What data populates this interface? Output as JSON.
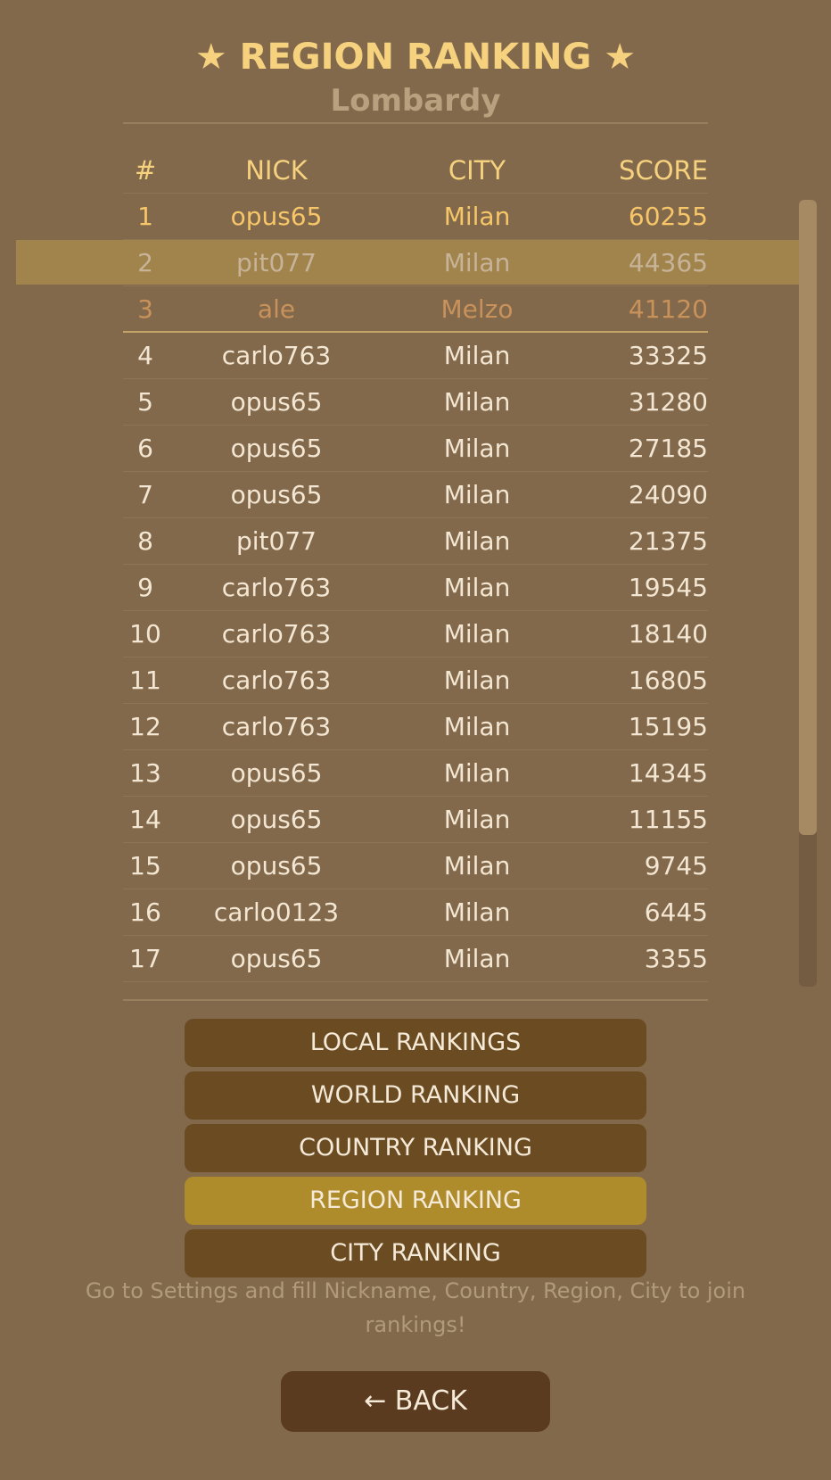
{
  "header": {
    "title": "★ REGION RANKING ★",
    "subtitle": "Lombardy"
  },
  "table": {
    "columns": [
      "#",
      "NICK",
      "CITY",
      "SCORE"
    ],
    "rows": [
      {
        "rank": "1",
        "nick": "opus65",
        "city": "Milan",
        "score": "60255"
      },
      {
        "rank": "2",
        "nick": "pit077",
        "city": "Milan",
        "score": "44365"
      },
      {
        "rank": "3",
        "nick": "ale",
        "city": "Melzo",
        "score": "41120"
      },
      {
        "rank": "4",
        "nick": "carlo763",
        "city": "Milan",
        "score": "33325"
      },
      {
        "rank": "5",
        "nick": "opus65",
        "city": "Milan",
        "score": "31280"
      },
      {
        "rank": "6",
        "nick": "opus65",
        "city": "Milan",
        "score": "27185"
      },
      {
        "rank": "7",
        "nick": "opus65",
        "city": "Milan",
        "score": "24090"
      },
      {
        "rank": "8",
        "nick": "pit077",
        "city": "Milan",
        "score": "21375"
      },
      {
        "rank": "9",
        "nick": "carlo763",
        "city": "Milan",
        "score": "19545"
      },
      {
        "rank": "10",
        "nick": "carlo763",
        "city": "Milan",
        "score": "18140"
      },
      {
        "rank": "11",
        "nick": "carlo763",
        "city": "Milan",
        "score": "16805"
      },
      {
        "rank": "12",
        "nick": "carlo763",
        "city": "Milan",
        "score": "15195"
      },
      {
        "rank": "13",
        "nick": "opus65",
        "city": "Milan",
        "score": "14345"
      },
      {
        "rank": "14",
        "nick": "opus65",
        "city": "Milan",
        "score": "11155"
      },
      {
        "rank": "15",
        "nick": "opus65",
        "city": "Milan",
        "score": "9745"
      },
      {
        "rank": "16",
        "nick": "carlo0123",
        "city": "Milan",
        "score": "6445"
      },
      {
        "rank": "17",
        "nick": "opus65",
        "city": "Milan",
        "score": "3355"
      }
    ]
  },
  "nav": {
    "buttons": [
      {
        "label": "LOCAL RANKINGS",
        "active": false
      },
      {
        "label": "WORLD RANKING",
        "active": false
      },
      {
        "label": "COUNTRY RANKING",
        "active": false
      },
      {
        "label": "REGION RANKING",
        "active": true
      },
      {
        "label": "CITY RANKING",
        "active": false
      }
    ]
  },
  "info_text": "Go to Settings and fill Nickname, Country, Region, City to join rankings!",
  "back_label": "← BACK",
  "colors": {
    "background": "#82694c",
    "gold": "#f6c668",
    "silver": "#c7b398",
    "bronze": "#c9925a",
    "active_button": "#ae8b2b",
    "button": "#6a4b22"
  }
}
